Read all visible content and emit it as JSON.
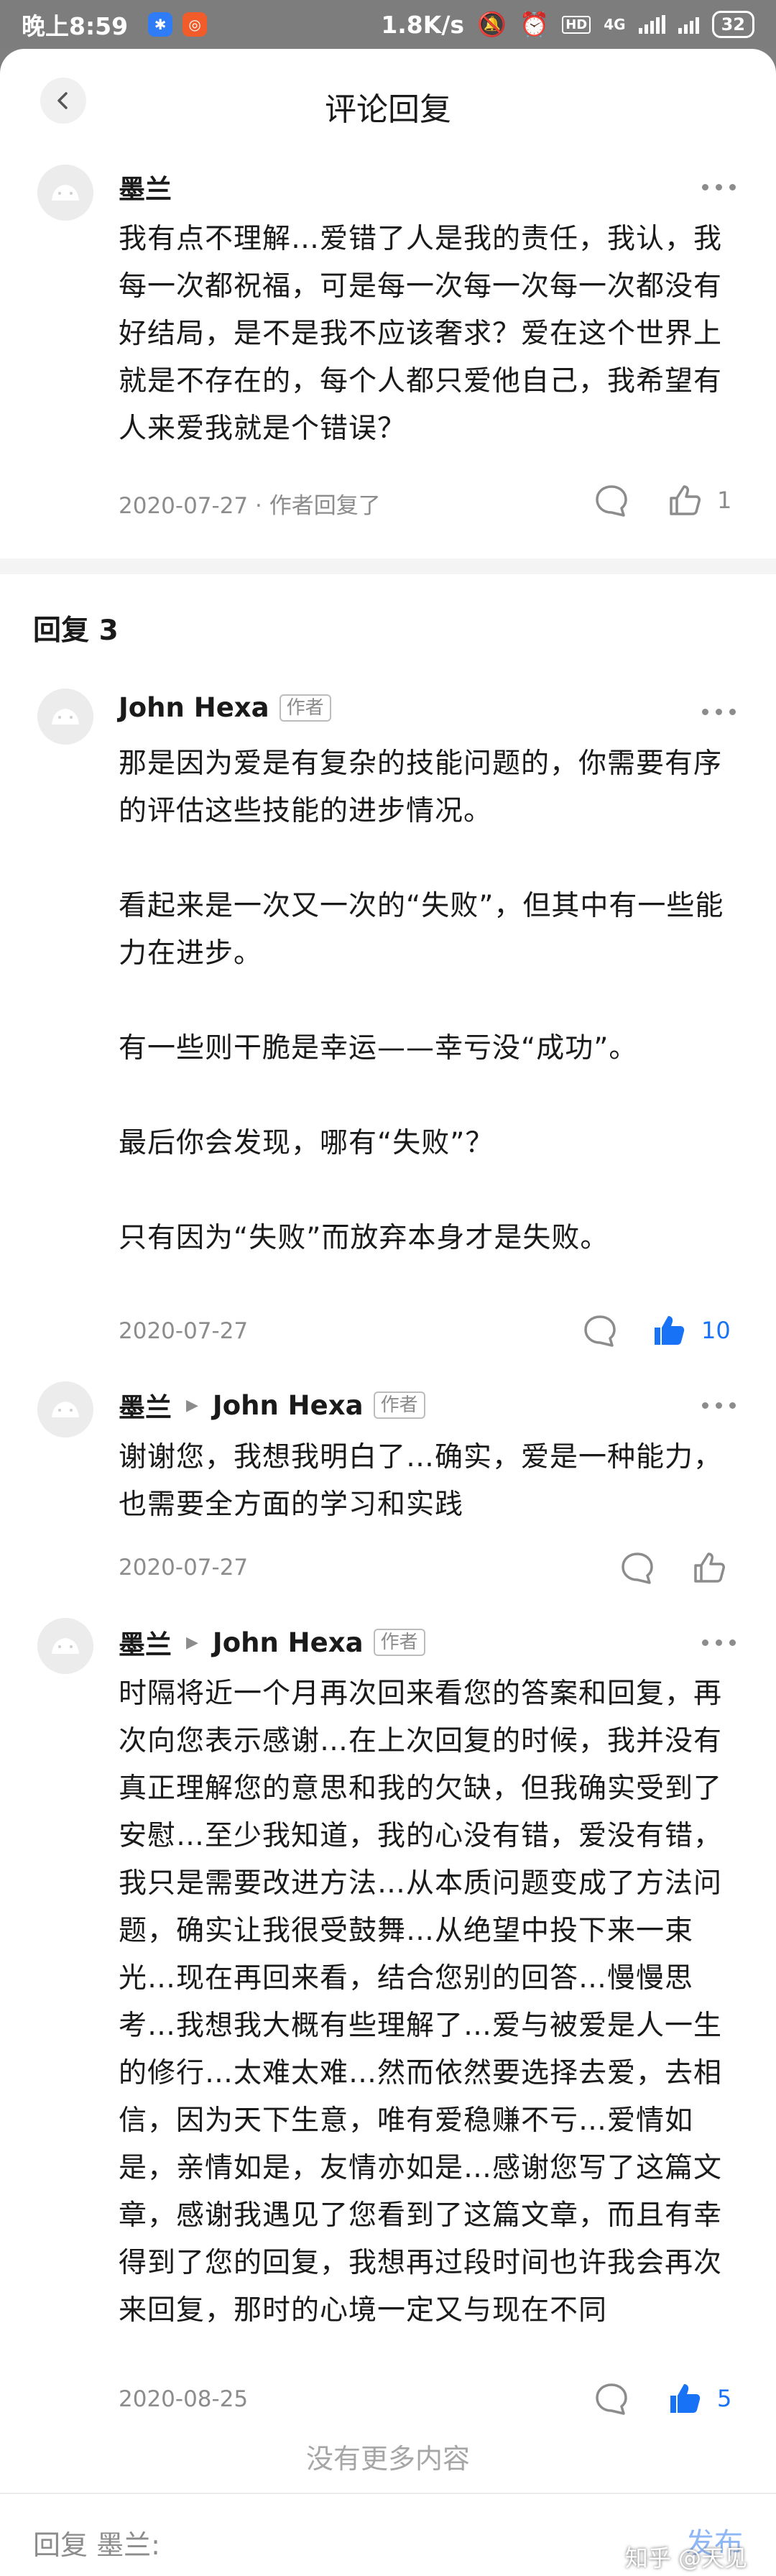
{
  "status_bar": {
    "time": "晚上8:59",
    "net_speed": "1.8K/s",
    "network": "4G",
    "hd": "HD",
    "battery": "32"
  },
  "header": {
    "title": "评论回复"
  },
  "root_comment": {
    "author": "墨兰",
    "text": "我有点不理解…爱错了人是我的责任，我认，我每一次都祝福，可是每一次每一次每一次都没有好结局，是不是我不应该奢求？爱在这个世界上就是不存在的，每个人都只爱他自己，我希望有人来爱我就是个错误？",
    "date": "2020-07-27 · 作者回复了",
    "likes": "1"
  },
  "section": {
    "title": "回复 3"
  },
  "replies": [
    {
      "author": "John Hexa",
      "tag": "作者",
      "paragraphs": [
        "那是因为爱是有复杂的技能问题的，你需要有序的评估这些技能的进步情况。",
        "看起来是一次又一次的“失败”，但其中有一些能力在进步。",
        "有一些则干脆是幸运——幸亏没“成功”。",
        "最后你会发现，哪有“失败”？",
        "只有因为“失败”而放弃本身才是失败。"
      ],
      "date": "2020-07-27",
      "likes": "10"
    },
    {
      "author": "墨兰",
      "reply_to": "John Hexa",
      "tag": "作者",
      "text": "谢谢您，我想我明白了…确实，爱是一种能力，也需要全方面的学习和实践",
      "date": "2020-07-27"
    },
    {
      "author": "墨兰",
      "reply_to": "John Hexa",
      "tag": "作者",
      "text": "时隔将近一个月再次回来看您的答案和回复，再次向您表示感谢…在上次回复的时候，我并没有真正理解您的意思和我的欠缺，但我确实受到了安慰…至少我知道，我的心没有错，爱没有错，我只是需要改进方法…从本质问题变成了方法问题，确实让我很受鼓舞…从绝望中投下来一束光…现在再回来看，结合您别的回答…慢慢思考…我想我大概有些理解了…爱与被爱是人一生的修行…太难太难…然而依然要选择去爱，去相信，因为天下生意，唯有爱稳赚不亏…爱情如是，亲情如是，友情亦如是…感谢您写了这篇文章，感谢我遇见了您看到了这篇文章，而且有幸得到了您的回复，我想再过段时间也许我会再次来回复，那时的心境一定又与现在不同",
      "date": "2020-08-25",
      "likes": "5"
    }
  ],
  "footer": {
    "no_more": "没有更多内容",
    "reply_placeholder": "回复 墨兰:",
    "publish": "发布",
    "watermark": "知乎 @天见"
  },
  "colors": {
    "accent": "#1772f6",
    "muted": "#8c8c8c"
  }
}
